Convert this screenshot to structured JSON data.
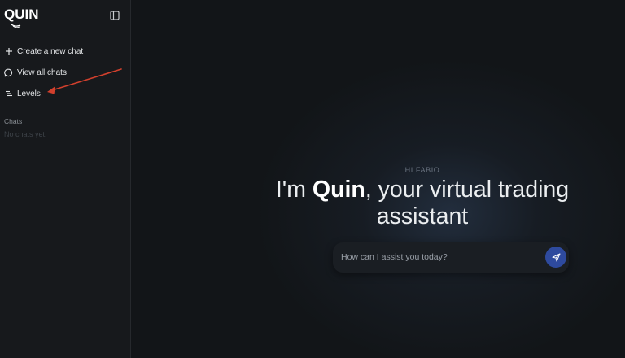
{
  "app": {
    "logo_text": "QUIN"
  },
  "sidebar": {
    "toggle_icon": "sidebar-toggle-icon",
    "items": [
      {
        "label": "Create a new chat",
        "icon": "plus-icon"
      },
      {
        "label": "View all chats",
        "icon": "chat-bubble-icon"
      },
      {
        "label": "Levels",
        "icon": "levels-icon"
      }
    ],
    "chats_section_title": "Chats",
    "chats_empty_text": "No chats yet."
  },
  "annotation": {
    "arrow_color": "#d2402d"
  },
  "main": {
    "greeting": "HI FABIO",
    "headline_prefix": "I'm ",
    "headline_bold": "Quin",
    "headline_suffix": ", your virtual trading assistant",
    "input_placeholder": "How can I assist you today?",
    "send_icon": "send-icon",
    "send_color": "#2e4a9e"
  }
}
